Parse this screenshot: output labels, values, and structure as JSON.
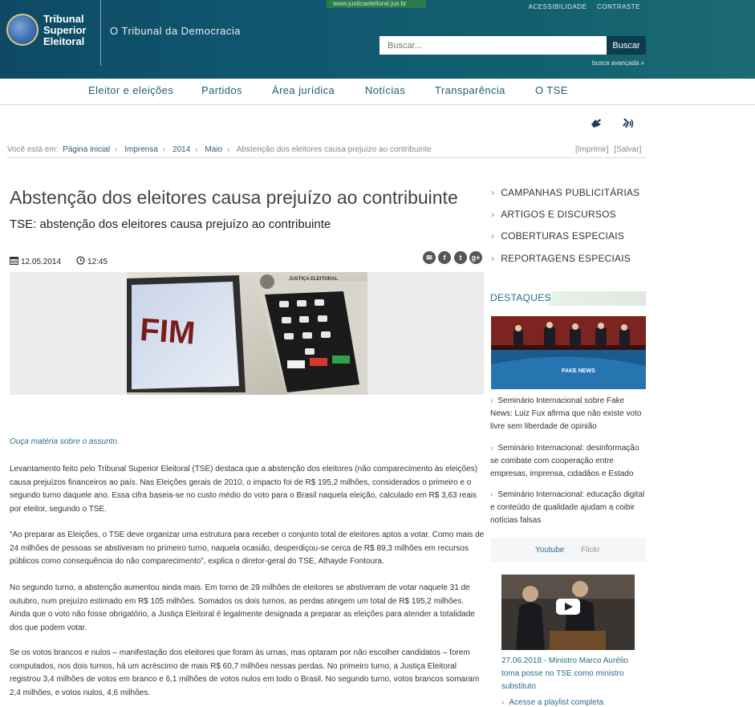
{
  "header": {
    "logo_line1": "Tribunal",
    "logo_line2": "Superior",
    "logo_line3": "Eleitoral",
    "tagline": "O Tribunal da Democracia",
    "url_strip": "www.justicaeleitoral.jus.br",
    "accessibility_link": "ACESSIBILIDADE",
    "contrast_link": "CONTRASTE",
    "search_placeholder": "Buscar...",
    "search_button": "Buscar",
    "advanced_search": "busca avançada »"
  },
  "nav": {
    "items": [
      "Eleitor e eleições",
      "Partidos",
      "Área jurídica",
      "Notícias",
      "Transparência",
      "O TSE"
    ]
  },
  "breadcrumb": {
    "prefix": "Você está em:",
    "items": [
      "Página inicial",
      "Imprensa",
      "2014",
      "Maio"
    ],
    "current": "Abstenção dos eleitores causa prejuízo ao contribuinte",
    "print": "[Imprimir]",
    "save": "[Salvar]"
  },
  "article": {
    "title": "Abstenção dos eleitores causa prejuízo ao contribuinte",
    "subtitle": "TSE: abstenção dos eleitores causa prejuízo ao contribuinte",
    "date": "12.05.2014",
    "time": "12:45",
    "photo_label_fim": "FIM",
    "photo_label_je": "JUSTIÇA ELEITORAL",
    "audio_link": "Ouça matéria sobre o assunto.",
    "paragraphs": [
      "Levantamento feito pelo Tribunal Superior Eleitoral (TSE) destaca que a abstenção dos eleitores (não comparecimento às eleições) causa prejuízos financeiros ao país. Nas Eleições gerais de 2010, o impacto foi de R$ 195,2 milhões, considerados o primeiro e o segundo turno daquele ano. Essa cifra baseia-se no custo médio do voto para o Brasil naquela eleição, calculado em R$ 3,63 reais por eleitor, segundo o TSE.",
      "“Ao preparar as Eleições, o TSE deve organizar uma estrutura para receber o conjunto total de eleitores aptos a votar. Como mais de 24 milhões de pessoas se abstiveram no primeiro turno, naquela ocasião, desperdiçou-se cerca de R$ 89,3 milhões em recursos públicos como consequência do não comparecimento”, explica o diretor-geral do TSE, Athayde Fontoura.",
      "No segundo turno, a abstenção aumentou ainda mais. Em torno de 29 milhões de eleitores se abstiveram de votar naquele 31 de outubro, num prejuízo estimado em R$ 105 milhões. Somados os dois turnos, as perdas atingem um total de R$ 195,2 milhões. Ainda que o voto não fosse obrigatório, a Justiça Eleitoral é legalmente designada a preparar as eleições para atender a totalidade dos que podem votar.",
      "Se os votos brancos e nulos – manifestação dos eleitores que foram às urnas, mas optaram por não escolher candidatos – forem computados, nos dois turnos, há um acréscimo de mais R$ 60,7 milhões nessas perdas. No primeiro turno, a Justiça Eleitoral registrou 3,4 milhões de votos em branco e 6,1 milhões de votos nulos em todo o Brasil. No segundo turno, votos brancos somaram 2,4 milhões, e votos nulos, 4,6 milhões."
    ]
  },
  "sidebar": {
    "links": [
      "CAMPANHAS PUBLICITÁRIAS",
      "ARTIGOS E DISCURSOS",
      "COBERTURAS ESPECIAIS",
      "REPORTAGENS ESPECIAIS"
    ],
    "destaques_title": "DESTAQUES",
    "destaque_img_text": "FAKE NEWS",
    "news": [
      "Seminário Internacional sobre Fake News: Luiz Fux afirma que não existe voto livre sem liberdade de opinião",
      "Seminário Internacional: desinformação se combate com cooperação entre empresas, imprensa, cidadãos e Estado",
      "Seminário Internacional: educação digital e conteúdo de qualidade ajudam a coibir notícias falsas"
    ],
    "tab_youtube": "Youtube",
    "tab_flickr": "Flickr",
    "video_caption": "27.06.2018 - Ministro Marco Aurélio toma posse no TSE como ministro substituto",
    "playlist_link": "Acesse a playlist completa"
  }
}
